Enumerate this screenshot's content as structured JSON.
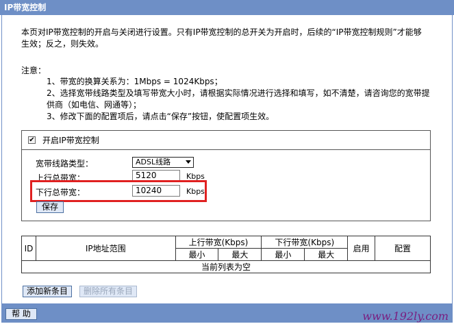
{
  "window": {
    "title": "IP带宽控制"
  },
  "intro": {
    "line1": "本页对IP带宽控制的开启与关闭进行设置。只有IP带宽控制的总开关为开启时，后续的“IP带宽控制规则”才能够",
    "line2": "生效；反之，则失效。"
  },
  "notes": {
    "heading": "注意：",
    "items": [
      "1、带宽的换算关系为：1Mbps = 1024Kbps；",
      "2、选择宽带线路类型及填写带宽大小时，请根据实际情况进行选择和填写，如不清楚，请咨询您的宽带提",
      "供商（如电信、网通等）；",
      "3、修改下面的配置项后，请点击“保存”按钮，使配置项生效。"
    ]
  },
  "control": {
    "enable_label": "开启IP带宽控制",
    "enabled": true,
    "line_type_label": "宽带线路类型：",
    "line_type_value": "ADSL线路",
    "upload_label": "上行总带宽：",
    "upload_value": "5120",
    "download_label": "下行总带宽：",
    "download_value": "10240",
    "unit": "Kbps",
    "save_label": "保存"
  },
  "rules_table": {
    "headers": {
      "id": "ID",
      "ip_range": "IP地址范围",
      "up": "上行带宽(Kbps)",
      "down": "下行带宽(Kbps)",
      "enable": "启用",
      "config": "配置",
      "min": "最小",
      "max": "最大"
    },
    "empty_text": "当前列表为空"
  },
  "actions": {
    "add_label": "添加新条目",
    "delete_all_label": "删除所有条目"
  },
  "footer": {
    "help_label": "帮 助",
    "watermark": "www.192ly.com"
  }
}
